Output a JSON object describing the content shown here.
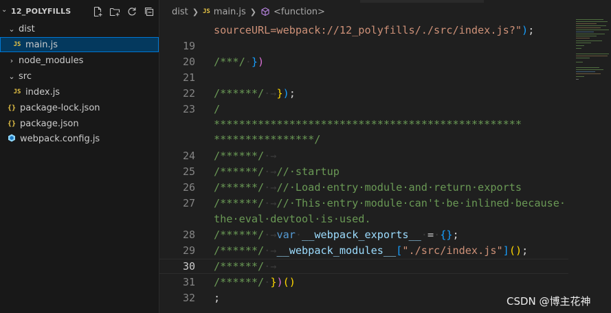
{
  "explorer": {
    "title": "12_POLYFILLS",
    "actions": [
      {
        "name": "new-file-icon"
      },
      {
        "name": "new-folder-icon"
      },
      {
        "name": "refresh-icon"
      },
      {
        "name": "collapse-all-icon"
      }
    ],
    "items": [
      {
        "label": "dist",
        "type": "folder",
        "expanded": true
      },
      {
        "label": "main.js",
        "type": "js",
        "selected": true
      },
      {
        "label": "node_modules",
        "type": "folder",
        "expanded": false
      },
      {
        "label": "src",
        "type": "folder",
        "expanded": true
      },
      {
        "label": "index.js",
        "type": "js"
      },
      {
        "label": "package-lock.json",
        "type": "json"
      },
      {
        "label": "package.json",
        "type": "json"
      },
      {
        "label": "webpack.config.js",
        "type": "webpack"
      }
    ],
    "icon_text": {
      "js": "JS",
      "json": "{}"
    }
  },
  "breadcrumb": {
    "folder": "dist",
    "file": "main.js",
    "symbol": "<function>"
  },
  "editor": {
    "current_line": "30",
    "lines": [
      {
        "n": "",
        "text": "sourceURL=webpack://12_polyfills/./src/index.js?\");"
      },
      {
        "n": "19",
        "text": ""
      },
      {
        "n": "20",
        "text": "/***/ })"
      },
      {
        "n": "21",
        "text": ""
      },
      {
        "n": "22",
        "text": "/******/ →});"
      },
      {
        "n": "23",
        "text": "/"
      },
      {
        "n": "",
        "text": "*************************************************"
      },
      {
        "n": "",
        "text": "****************/"
      },
      {
        "n": "24",
        "text": "/******/ →"
      },
      {
        "n": "25",
        "text": "/******/ →// startup"
      },
      {
        "n": "26",
        "text": "/******/ →// Load entry module and return exports"
      },
      {
        "n": "27",
        "text": "/******/ →// This entry module can't be inlined because"
      },
      {
        "n": "",
        "text": "the eval devtool is used."
      },
      {
        "n": "28",
        "text": "/******/ →var __webpack_exports__ = {};"
      },
      {
        "n": "29",
        "text": "/******/ →__webpack_modules__[\"./src/index.js\"]();"
      },
      {
        "n": "30",
        "text": "/******/ →"
      },
      {
        "n": "31",
        "text": "/******/ })()"
      },
      {
        "n": "32",
        "text": ";"
      }
    ],
    "colors": {
      "string": "#ce9178",
      "comment": "#6a9955",
      "keyword": "#569cd6",
      "variable": "#9cdcfe",
      "function": "#dcdcaa",
      "bracket1": "#da70d6",
      "bracket2": "#179fff",
      "bracket3": "#ffd700"
    }
  },
  "watermark": "CSDN @博主花神"
}
